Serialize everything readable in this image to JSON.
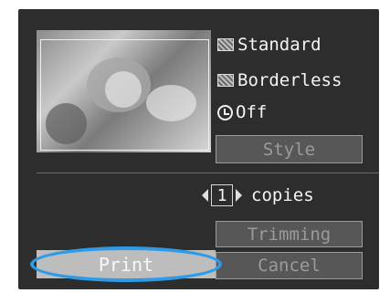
{
  "options": {
    "paper_style": "Standard",
    "border": "Borderless",
    "date": "Off"
  },
  "buttons": {
    "style": "Style",
    "trimming": "Trimming",
    "cancel": "Cancel",
    "print": "Print"
  },
  "copies": {
    "count": "1",
    "label": "copies"
  },
  "colors": {
    "highlight": "#2e9be8",
    "screen_bg": "#2d2d2d"
  },
  "icons": [
    "paper-style-icon",
    "border-icon",
    "date-clock-icon",
    "decrement-arrow-icon",
    "increment-arrow-icon"
  ]
}
